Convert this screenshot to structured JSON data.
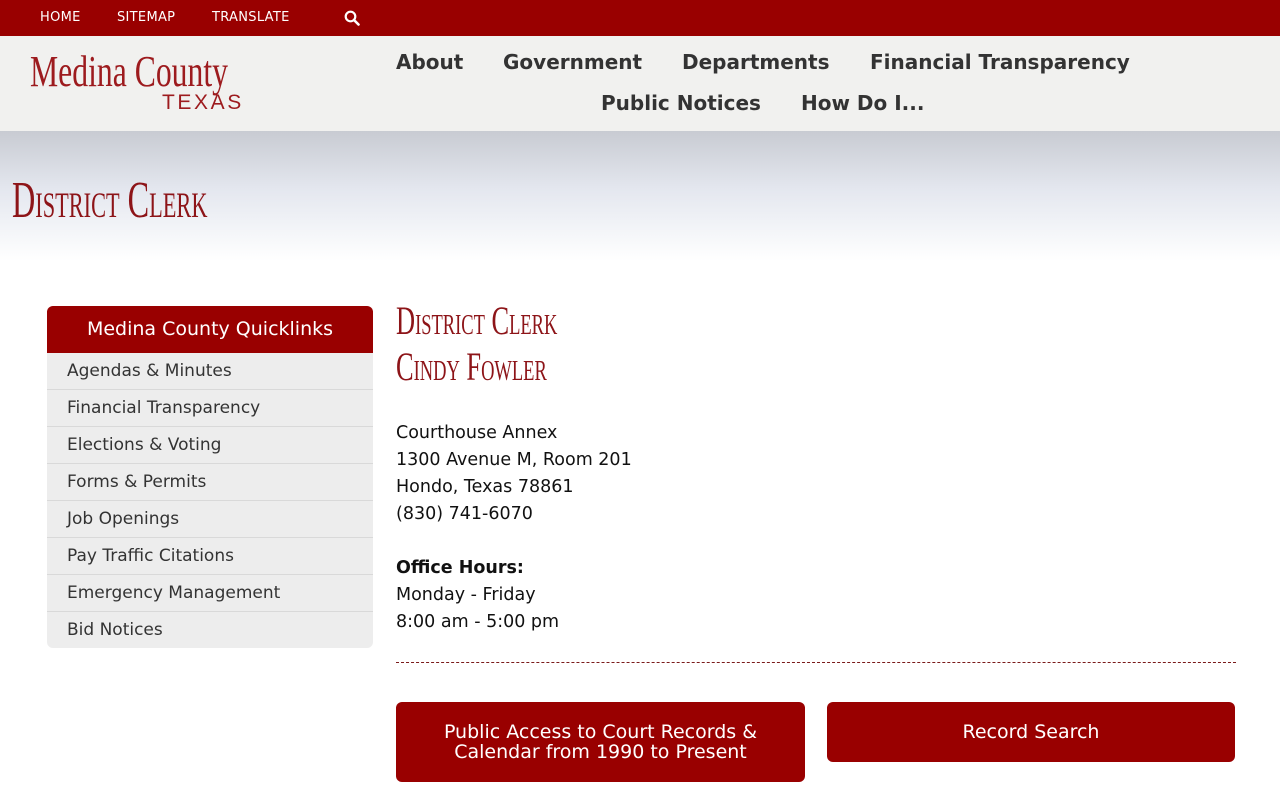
{
  "topbar": {
    "home": "HOME",
    "sitemap": "SITEMAP",
    "translate": "TRANSLATE",
    "search_icon": "search-icon"
  },
  "logo": {
    "main": "Medina County",
    "sub": "TEXAS"
  },
  "nav": {
    "about": "About",
    "government": "Government",
    "departments": "Departments",
    "financial": "Financial Transparency",
    "notices": "Public Notices",
    "howdoi": "How Do I..."
  },
  "banner": {
    "title": "District Clerk"
  },
  "quicklinks": {
    "heading": "Medina County Quicklinks",
    "items": [
      "Agendas & Minutes",
      "Financial Transparency",
      "Elections & Voting",
      "Forms & Permits",
      "Job Openings",
      "Pay Traffic Citations",
      "Emergency Management",
      "Bid Notices"
    ]
  },
  "content": {
    "heading_line1": "District Clerk",
    "heading_line2": "Cindy Fowler",
    "address": [
      "Courthouse Annex",
      "1300 Avenue M, Room 201",
      "Hondo, Texas 78861",
      "(830) 741-6070"
    ],
    "hours_label": "Office Hours:",
    "hours": [
      "Monday - Friday",
      "8:00 am - 5:00 pm"
    ],
    "btn_public_access_line1": "Public Access to Court Records &",
    "btn_public_access_line2": "Calendar from 1990 to Present",
    "btn_record_search": "Record Search"
  },
  "colors": {
    "brand": "#990000",
    "header_bg": "#f1f1ef"
  }
}
